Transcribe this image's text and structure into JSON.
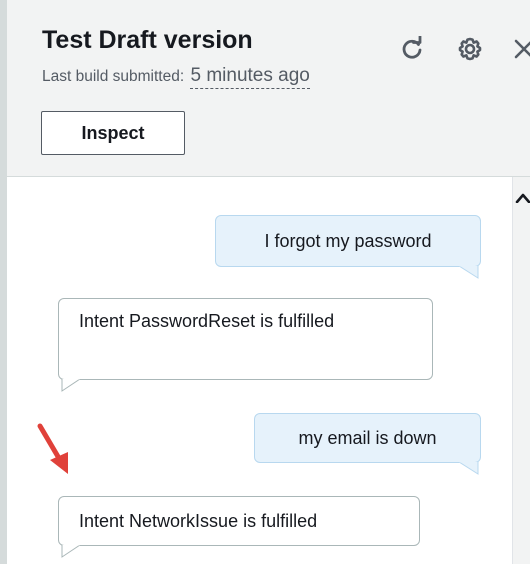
{
  "header": {
    "title": "Test Draft version",
    "subtitle_prefix": "Last build submitted:",
    "subtitle_time": "5 minutes ago",
    "inspect_label": "Inspect",
    "icons": [
      "refresh-icon",
      "settings-icon",
      "close-icon"
    ]
  },
  "chat": {
    "messages": [
      {
        "from": "user",
        "text": "I forgot my password"
      },
      {
        "from": "bot",
        "text": "Intent PasswordReset is fulfilled"
      },
      {
        "from": "user",
        "text": "my email is down"
      },
      {
        "from": "bot",
        "text": "Intent NetworkIssue is fulfilled"
      }
    ]
  },
  "colors": {
    "header_bg": "#f2f3f3",
    "user_bubble_bg": "#e6f2fb",
    "user_bubble_border": "#b8d8ef",
    "bot_bubble_border": "#aab7b8",
    "annotation_arrow": "#e0413a"
  }
}
